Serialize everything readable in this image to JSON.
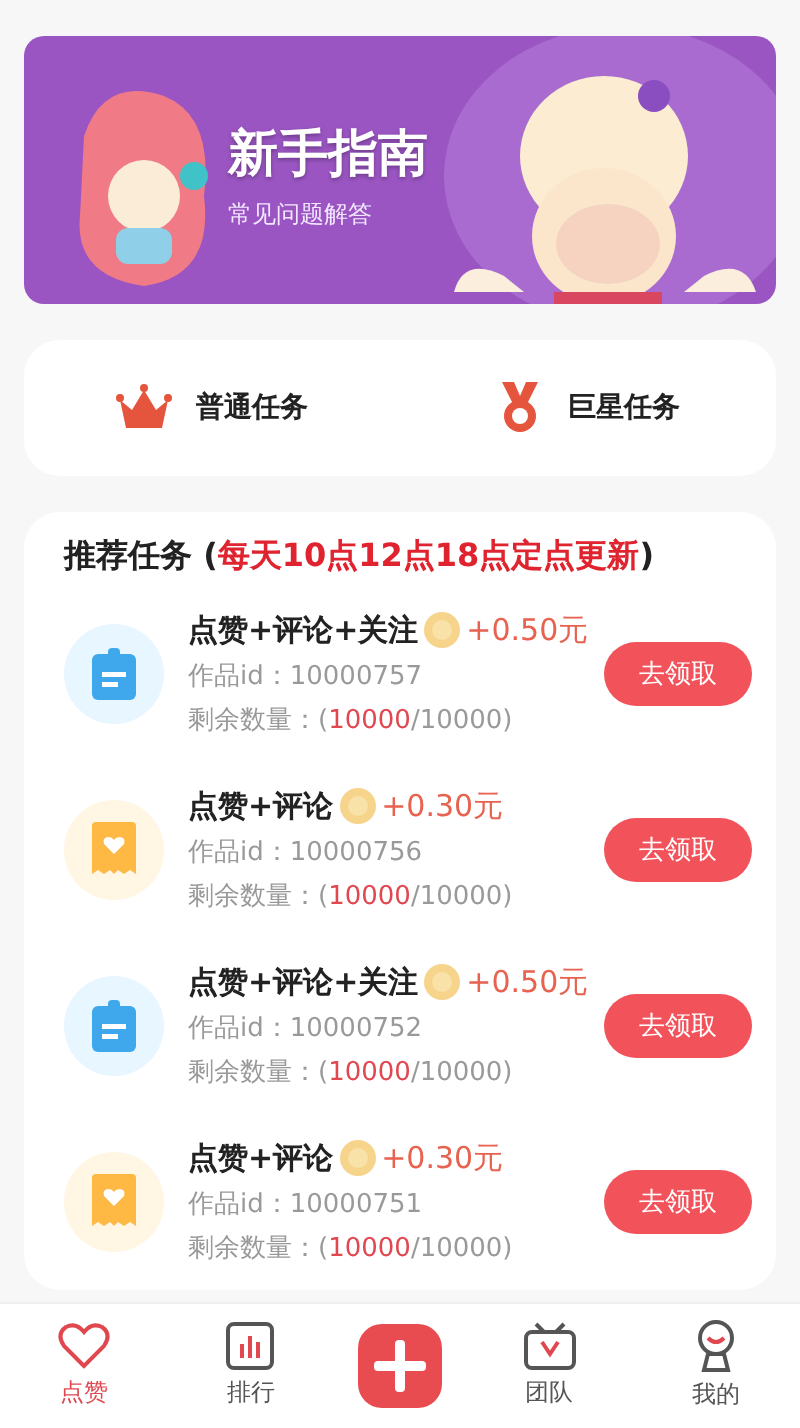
{
  "banner": {
    "title": "新手指南",
    "subtitle": "常见问题解答"
  },
  "task_types": [
    {
      "label": "普通任务",
      "kind": "crown"
    },
    {
      "label": "巨星任务",
      "kind": "medal"
    }
  ],
  "recommended": {
    "title": "推荐任务",
    "open": "(",
    "note": "每天10点12点18点定点更新",
    "close": ")"
  },
  "tasks": [
    {
      "kind": "clipboard",
      "title": "点赞+评论+关注",
      "reward": "+0.50元",
      "id_text": "作品id：10000757",
      "remaining": {
        "prefix": "剩余数量：(",
        "count": "10000",
        "suffix": "/10000)"
      },
      "button": "去领取"
    },
    {
      "kind": "heart",
      "title": "点赞+评论",
      "reward": "+0.30元",
      "id_text": "作品id：10000756",
      "remaining": {
        "prefix": "剩余数量：(",
        "count": "10000",
        "suffix": "/10000)"
      },
      "button": "去领取"
    },
    {
      "kind": "clipboard",
      "title": "点赞+评论+关注",
      "reward": "+0.50元",
      "id_text": "作品id：10000752",
      "remaining": {
        "prefix": "剩余数量：(",
        "count": "10000",
        "suffix": "/10000)"
      },
      "button": "去领取"
    },
    {
      "kind": "heart",
      "title": "点赞+评论",
      "reward": "+0.30元",
      "id_text": "作品id：10000751",
      "remaining": {
        "prefix": "剩余数量：(",
        "count": "10000",
        "suffix": "/10000)"
      },
      "button": "去领取"
    }
  ],
  "tabs": [
    {
      "kind": "heart",
      "label": "点赞",
      "selected": true
    },
    {
      "kind": "chart",
      "label": "排行",
      "selected": false
    },
    {
      "kind": "plus",
      "selected": false
    },
    {
      "kind": "tv",
      "label": "团队",
      "selected": false
    },
    {
      "kind": "user",
      "label": "我的",
      "selected": false
    }
  ]
}
